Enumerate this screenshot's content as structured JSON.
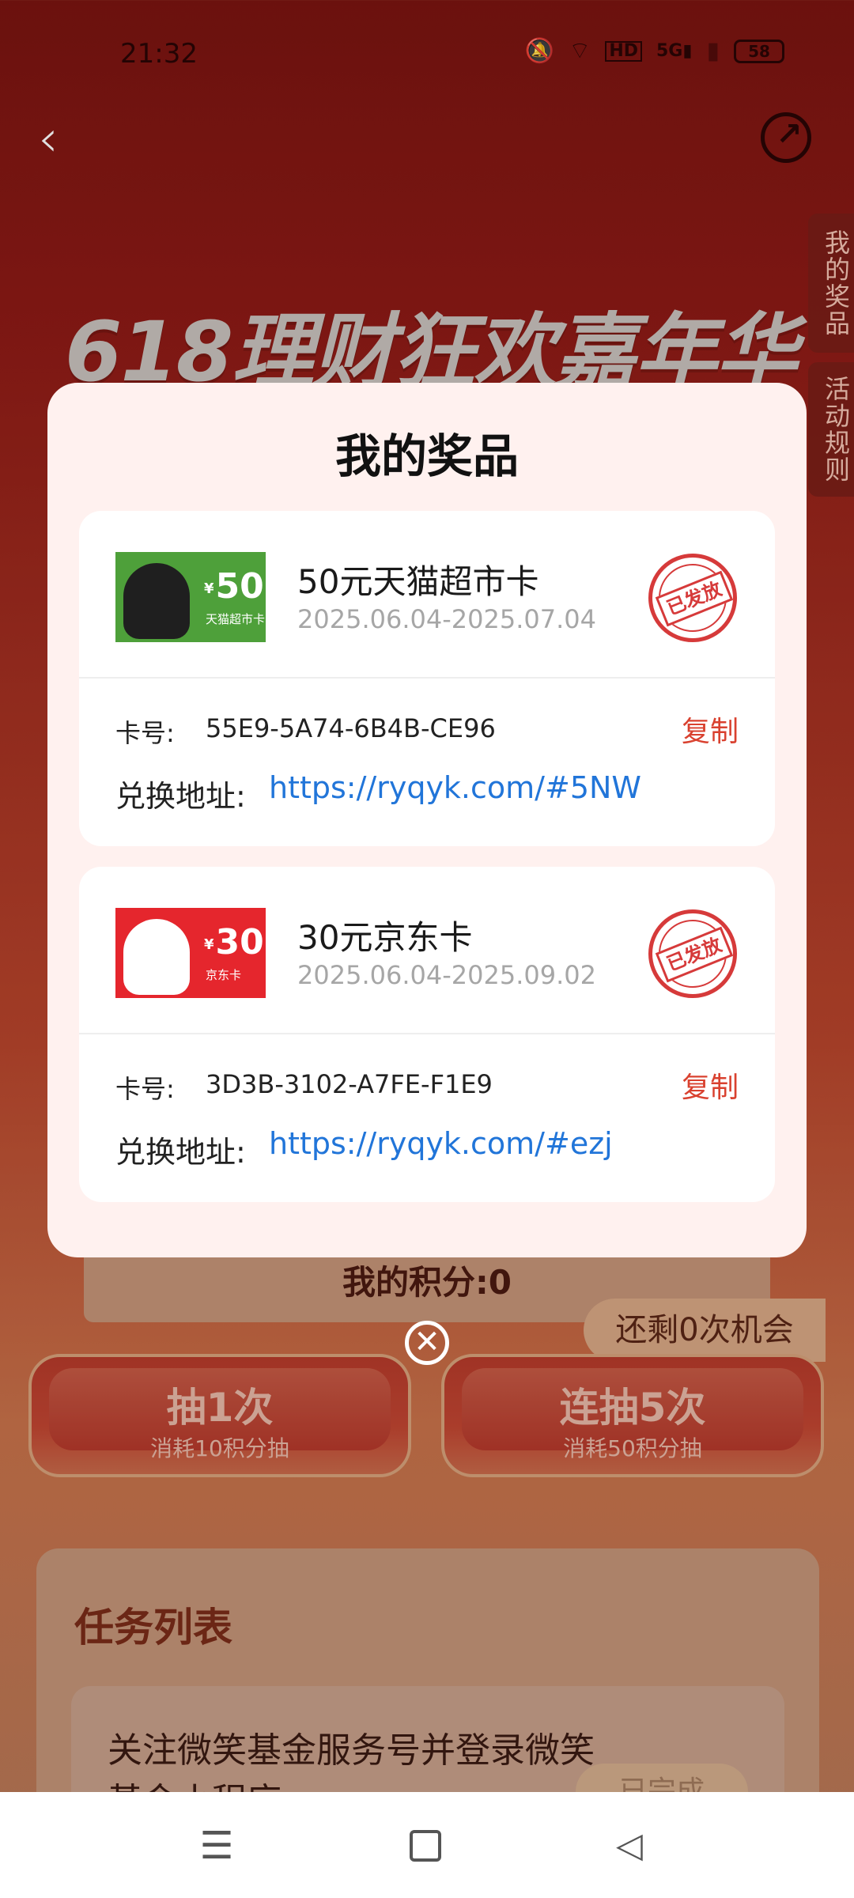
{
  "status_bar": {
    "time": "21:32",
    "battery": "58",
    "icons": [
      "mute-icon",
      "wifi-icon",
      "hd-icon",
      "signal-5g-icon",
      "signal-icon",
      "battery-icon"
    ]
  },
  "header": {
    "back_icon": "back-chevron-icon",
    "share_icon": "share-icon"
  },
  "side_tabs": {
    "my_prizes": "我的奖品",
    "rules": "活动规则"
  },
  "hero": {
    "title": "618理财狂欢嘉年华"
  },
  "modal": {
    "title": "我的奖品",
    "code_label": "卡号:",
    "addr_label": "兑换地址:",
    "copy_label": "复制",
    "stamp_label": "已发放",
    "prizes": [
      {
        "name": "50元天猫超市卡",
        "date": "2025.06.04-2025.07.04",
        "thumb_amount": "50",
        "thumb_yen": "¥",
        "thumb_label": "天猫超市卡",
        "code": "55E9-5A74-6B4B-CE96",
        "link": "https://ryqyk.com/#5NW"
      },
      {
        "name": "30元京东卡",
        "date": "2025.06.04-2025.09.02",
        "thumb_amount": "30",
        "thumb_yen": "¥",
        "thumb_label": "京东卡",
        "code": "3D3B-3102-A7FE-F1E9",
        "link": "https://ryqyk.com/#ezj"
      }
    ]
  },
  "points": {
    "label": "我的积分:0"
  },
  "chances": {
    "label": "还剩0次机会"
  },
  "draw_buttons": [
    {
      "main": "抽1次",
      "sub": "消耗10积分抽"
    },
    {
      "main": "连抽5次",
      "sub": "消耗50积分抽"
    }
  ],
  "tasks": {
    "title": "任务列表",
    "items": [
      {
        "text": "关注微笑基金服务号并登录微笑基金小程序",
        "status": "已完成"
      }
    ]
  },
  "nav": {
    "menu_icon": "menu-icon",
    "home_icon": "home-icon",
    "back_icon": "back-triangle-icon"
  },
  "colors": {
    "accent_red": "#d9412f",
    "link_blue": "#2175d9",
    "modal_bg": "#fff1ef"
  }
}
